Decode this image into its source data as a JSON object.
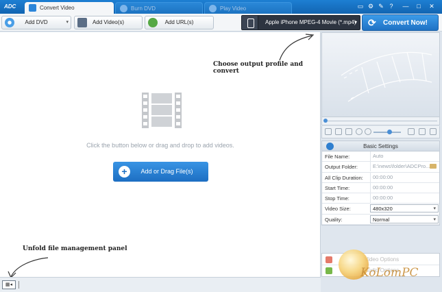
{
  "titlebar": {
    "logo": "ADC",
    "tabs": [
      {
        "label": "Convert Video",
        "active": true
      },
      {
        "label": "Burn DVD",
        "active": false
      },
      {
        "label": "Play Video",
        "active": false
      }
    ],
    "window_controls": [
      "▭",
      "⚙",
      "✎",
      "?",
      "—",
      "□",
      "✕"
    ]
  },
  "toolbar": {
    "add_dvd": "Add DVD",
    "add_videos": "Add Video(s)",
    "add_urls": "Add URL(s)",
    "profile": "Apple iPhone MPEG-4 Movie (*.mp4)",
    "convert_now": "Convert Now!"
  },
  "main": {
    "hint": "Click the button below or drag and drop to add videos.",
    "add_button": "Add or Drag File(s)"
  },
  "annotations": {
    "choose_output": "Choose output profile and convert",
    "unfold_panel": "Unfold file management panel"
  },
  "bottombar": {
    "unfold_icon": "▦◂"
  },
  "basic_settings": {
    "title": "Basic Settings",
    "rows": [
      {
        "label": "File Name:",
        "value": "Auto"
      },
      {
        "label": "Output Folder:",
        "value": "E:\\news\\folder\\ADCPro..."
      },
      {
        "label": "All Clip Duration:",
        "value": "00:00:00"
      },
      {
        "label": "Start Time:",
        "value": "00:00:00"
      },
      {
        "label": "Stop Time:",
        "value": "00:00:00"
      },
      {
        "label": "Video Size:",
        "value": "480x320"
      },
      {
        "label": "Quality:",
        "value": "Normal"
      }
    ]
  },
  "options": {
    "video_options": "Video Options",
    "audio_options": "Audio Options"
  },
  "watermark": "KoLomPC",
  "colors": {
    "titlebar": "#1265b2",
    "accent": "#1d6ec2",
    "profile_bg": "#2d3440"
  }
}
